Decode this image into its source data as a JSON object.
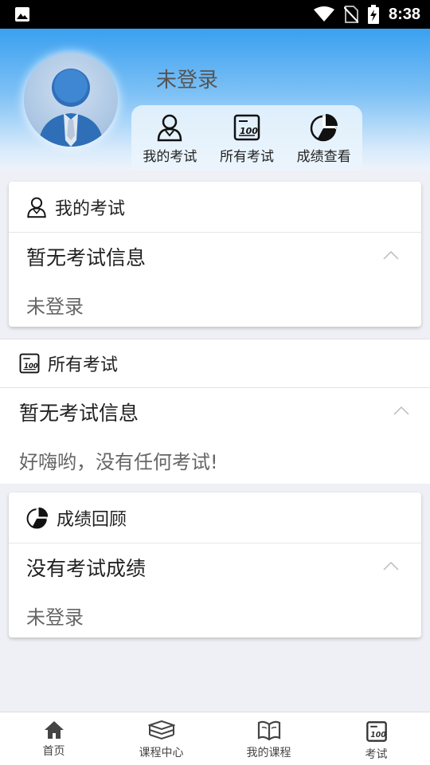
{
  "status": {
    "time": "8:38"
  },
  "profile": {
    "username": "未登录"
  },
  "quick_actions": [
    {
      "label": "我的考试",
      "icon": "user-icon"
    },
    {
      "label": "所有考试",
      "icon": "score-100-icon"
    },
    {
      "label": "成绩查看",
      "icon": "pie-chart-icon"
    }
  ],
  "my_exams": {
    "title": "我的考试",
    "message": "暂无考试信息",
    "detail": "未登录"
  },
  "all_exams": {
    "title": "所有考试",
    "message": "暂无考试信息",
    "detail": "好嗨哟，没有任何考试!"
  },
  "score_review": {
    "title": "成绩回顾",
    "message": "没有考试成绩",
    "detail": "未登录"
  },
  "bottom_nav": [
    {
      "label": "首页",
      "icon": "home-icon"
    },
    {
      "label": "课程中心",
      "icon": "books-icon"
    },
    {
      "label": "我的课程",
      "icon": "open-book-icon"
    },
    {
      "label": "考试",
      "icon": "exam-icon"
    }
  ]
}
